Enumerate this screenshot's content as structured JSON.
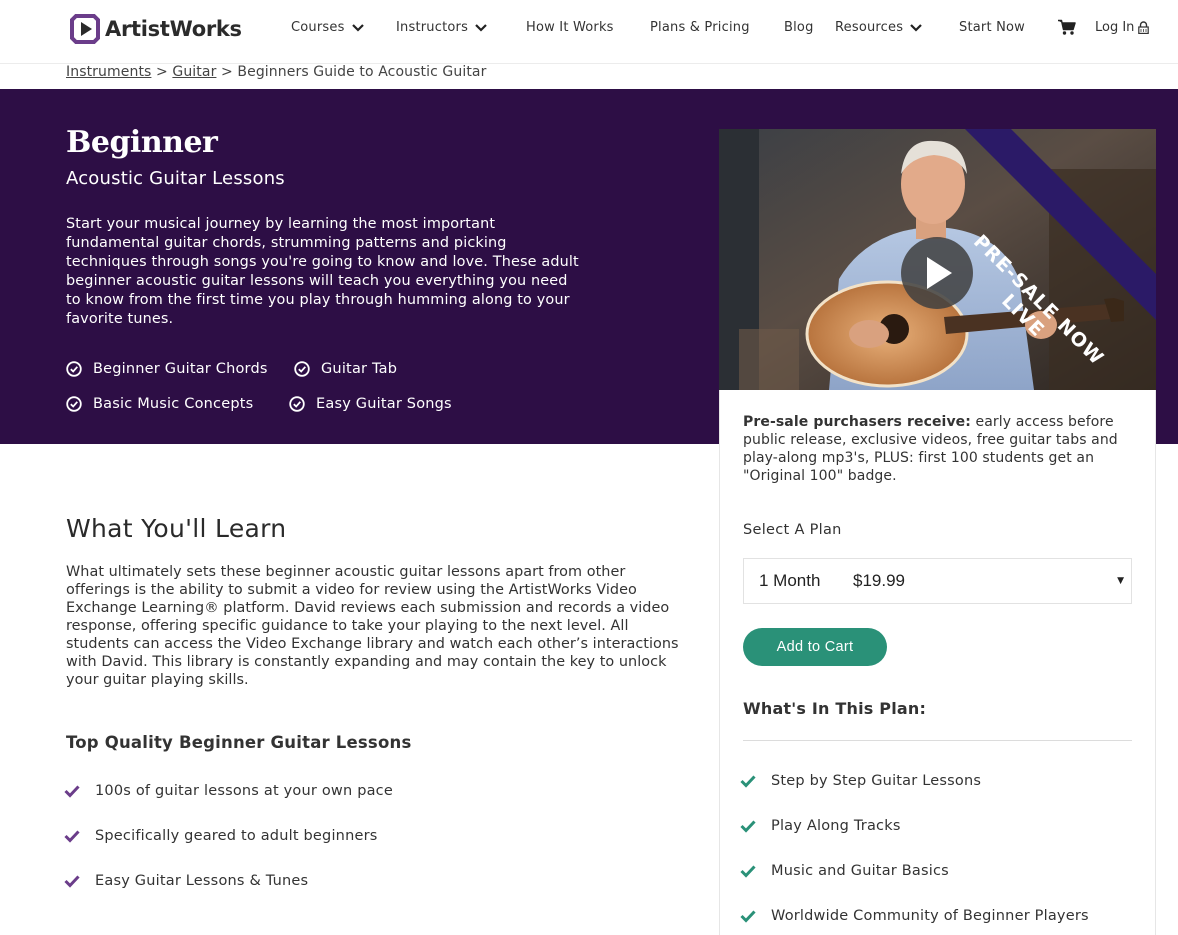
{
  "brand": {
    "name": "ArtistWorks",
    "accent": "#2d0e45",
    "logo_color": "#6b3d8a",
    "button_color": "#2a9178"
  },
  "nav": {
    "items": [
      {
        "label": "Courses",
        "dropdown": true
      },
      {
        "label": "Instructors",
        "dropdown": true
      },
      {
        "label": "How It Works",
        "dropdown": false
      },
      {
        "label": "Plans & Pricing",
        "dropdown": false
      },
      {
        "label": "Blog",
        "dropdown": false
      },
      {
        "label": "Resources",
        "dropdown": true
      },
      {
        "label": "Start Now",
        "dropdown": false
      }
    ],
    "cart_icon": "cart-icon",
    "login_label": "Log In",
    "login_icon": "lock-icon"
  },
  "breadcrumb": {
    "items": [
      "Instruments",
      "Guitar"
    ],
    "separator": ">",
    "current": "Beginners Guide to Acoustic Guitar"
  },
  "hero": {
    "title": "Beginner",
    "subtitle": "Acoustic Guitar Lessons",
    "description": "Start your musical journey by learning the most important fundamental guitar chords, strumming patterns and picking techniques through songs you're going to know and love. These adult beginner acoustic guitar lessons will teach you everything you need to know from the first time you play through humming along to your favorite tunes.",
    "features": [
      "Beginner Guitar Chords",
      "Guitar Tab",
      "Basic Music Concepts",
      "Easy Guitar Songs"
    ],
    "banner": "PRE-SALE NOW LIVE"
  },
  "sidebar": {
    "presale_bold": "Pre-sale purchasers receive:",
    "presale_text": " early access before public release, exclusive videos, free guitar tabs and play-along mp3's, PLUS: first 100 students get an \"Original 100\" badge.",
    "select_label": "Select A Plan",
    "selected_plan": {
      "term": "1 Month",
      "price": "$19.99"
    },
    "add_to_cart": "Add to Cart",
    "in_plan_title": "What's In This Plan:",
    "in_plan_items": [
      "Step by Step Guitar Lessons",
      "Play Along Tracks",
      "Music and Guitar Basics",
      "Worldwide Community of Beginner Players"
    ]
  },
  "learn": {
    "title": "What You'll Learn",
    "body": "What ultimately sets these beginner acoustic guitar lessons apart from other offerings is the ability to submit a video for review using the ArtistWorks Video Exchange Learning® platform. David reviews each submission and records a video response, offering specific guidance to take your playing to the next level. All students can access the Video Exchange library and watch each other’s interactions with David. This library is constantly expanding and may contain the key to unlock your guitar playing skills.",
    "quality_title": "Top Quality Beginner Guitar Lessons",
    "quality_items": [
      "100s of guitar lessons at your own pace",
      "Specifically geared to adult beginners",
      "Easy Guitar Lessons & Tunes"
    ]
  }
}
